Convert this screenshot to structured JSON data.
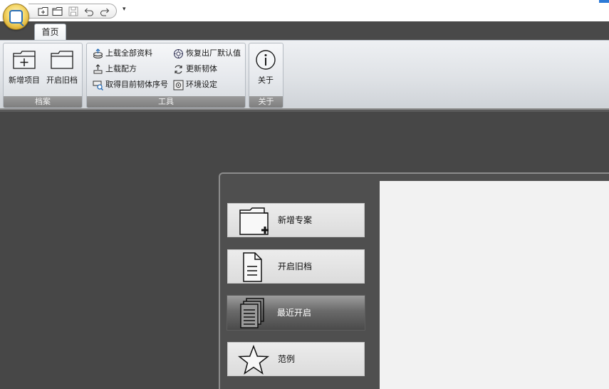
{
  "quick_access": {
    "items": [
      "new-icon",
      "open-icon",
      "save-icon",
      "undo-icon",
      "redo-icon"
    ],
    "more_label": "▾"
  },
  "tabs": [
    {
      "label": "首页",
      "active": true
    }
  ],
  "ribbon": {
    "groups": {
      "file": {
        "label": "档案",
        "new_project": "新增项目",
        "open_file": "开启旧档"
      },
      "tools": {
        "label": "工具",
        "upload_all": "上载全部资料",
        "upload_recipe": "上载配方",
        "get_firmware_sn": "取得目前韧体序号",
        "restore_defaults": "恢复出厂默认值",
        "update_firmware": "更新韧体",
        "environment": "环境设定"
      },
      "about": {
        "label": "关于",
        "about_button": "关于"
      }
    }
  },
  "start_menu": {
    "items": [
      {
        "label": "新增专案",
        "icon": "folder-plus-icon",
        "active": false
      },
      {
        "label": "开启旧档",
        "icon": "document-icon",
        "active": false
      },
      {
        "label": "最近开启",
        "icon": "documents-stack-icon",
        "active": true
      },
      {
        "label": "范例",
        "icon": "star-icon",
        "active": false
      }
    ]
  },
  "colors": {
    "workspace_bg": "#474747",
    "active_item_bg": "#6a6a6a",
    "accent": "#2b6fb8"
  }
}
